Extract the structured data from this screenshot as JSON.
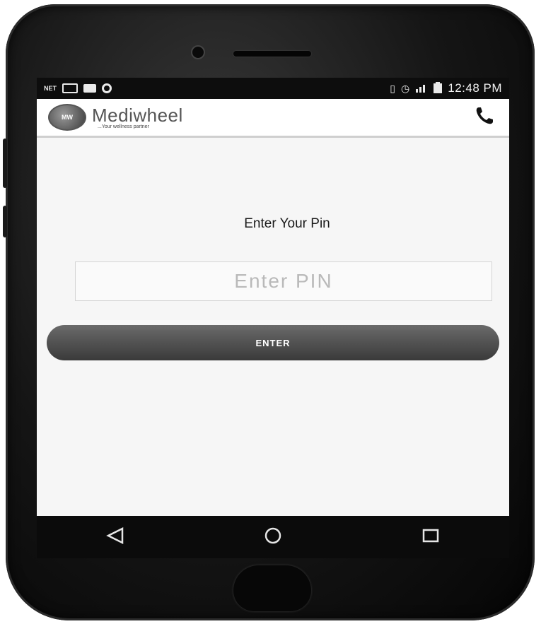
{
  "status_bar": {
    "carrier_icon": "NET",
    "icons": [
      "gmail-icon",
      "image-icon",
      "circle-notification-icon",
      "vibrate-icon",
      "alarm-icon",
      "signal-icon",
      "battery-icon"
    ],
    "time": "12:48 PM"
  },
  "app_bar": {
    "logo_badge": "MW",
    "brand_name": "Mediwheel",
    "tagline": "...Your wellness partner",
    "action_icon": "phone-icon"
  },
  "pin_screen": {
    "label": "Enter Your Pin",
    "pin_input": {
      "value": "",
      "placeholder": "Enter PIN"
    },
    "enter_button_label": "ENTER"
  },
  "nav_bar": {
    "buttons": [
      "back-icon",
      "home-icon",
      "recents-icon"
    ]
  }
}
